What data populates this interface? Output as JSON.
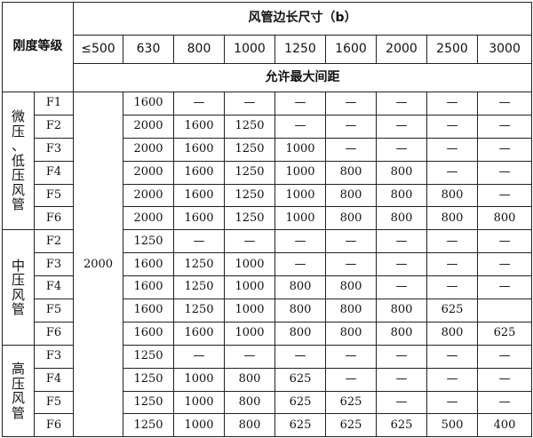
{
  "table": {
    "header_dim": "风管边长尺寸（b）",
    "header_stiffness": "刚度等级",
    "dims": [
      "≤500",
      "630",
      "800",
      "1000",
      "1250",
      "1600",
      "2000",
      "2500",
      "3000"
    ],
    "header_spacing": "允许最大间距",
    "common_500": "2000",
    "groups": [
      {
        "name": "微压、低压风管",
        "chars": [
          "微",
          "压",
          "、",
          "低",
          "压",
          "风",
          "管"
        ],
        "rows": [
          {
            "level": "F1",
            "cells": [
              "1600",
              "—",
              "—",
              "—",
              "—",
              "—",
              "—",
              "—"
            ]
          },
          {
            "level": "F2",
            "cells": [
              "2000",
              "1600",
              "1250",
              "—",
              "—",
              "—",
              "—",
              "—"
            ]
          },
          {
            "level": "F3",
            "cells": [
              "2000",
              "1600",
              "1250",
              "1000",
              "—",
              "—",
              "—",
              "—"
            ]
          },
          {
            "level": "F4",
            "cells": [
              "2000",
              "1600",
              "1250",
              "1000",
              "800",
              "800",
              "—",
              "—"
            ]
          },
          {
            "level": "F5",
            "cells": [
              "2000",
              "1600",
              "1250",
              "1000",
              "800",
              "800",
              "800",
              "—"
            ]
          },
          {
            "level": "F6",
            "cells": [
              "2000",
              "1600",
              "1250",
              "1000",
              "800",
              "800",
              "800",
              "800"
            ]
          }
        ]
      },
      {
        "name": "中压风管",
        "chars": [
          "中",
          "压",
          "风",
          "管"
        ],
        "rows": [
          {
            "level": "F2",
            "cells": [
              "1250",
              "—",
              "—",
              "—",
              "—",
              "—",
              "—",
              "—"
            ]
          },
          {
            "level": "F3",
            "cells": [
              "1600",
              "1250",
              "1000",
              "—",
              "—",
              "—",
              "—",
              "—"
            ]
          },
          {
            "level": "F4",
            "cells": [
              "1600",
              "1250",
              "1000",
              "800",
              "800",
              "—",
              "—",
              "—"
            ]
          },
          {
            "level": "F5",
            "cells": [
              "1600",
              "1250",
              "1000",
              "800",
              "800",
              "800",
              "625",
              ""
            ]
          },
          {
            "level": "F6",
            "cells": [
              "1600",
              "1600",
              "1000",
              "800",
              "800",
              "800",
              "800",
              "625"
            ]
          }
        ]
      },
      {
        "name": "高压风管",
        "chars": [
          "高",
          "压",
          "风",
          "管"
        ],
        "rows": [
          {
            "level": "F3",
            "cells": [
              "1250",
              "—",
              "—",
              "—",
              "—",
              "—",
              "—",
              "—"
            ]
          },
          {
            "level": "F4",
            "cells": [
              "1250",
              "1000",
              "800",
              "625",
              "—",
              "—",
              "—",
              "—"
            ]
          },
          {
            "level": "F5",
            "cells": [
              "1250",
              "1000",
              "800",
              "625",
              "625",
              "—",
              "—",
              "—"
            ]
          },
          {
            "level": "F6",
            "cells": [
              "1250",
              "1000",
              "800",
              "625",
              "625",
              "625",
              "500",
              "400"
            ]
          }
        ]
      }
    ]
  }
}
